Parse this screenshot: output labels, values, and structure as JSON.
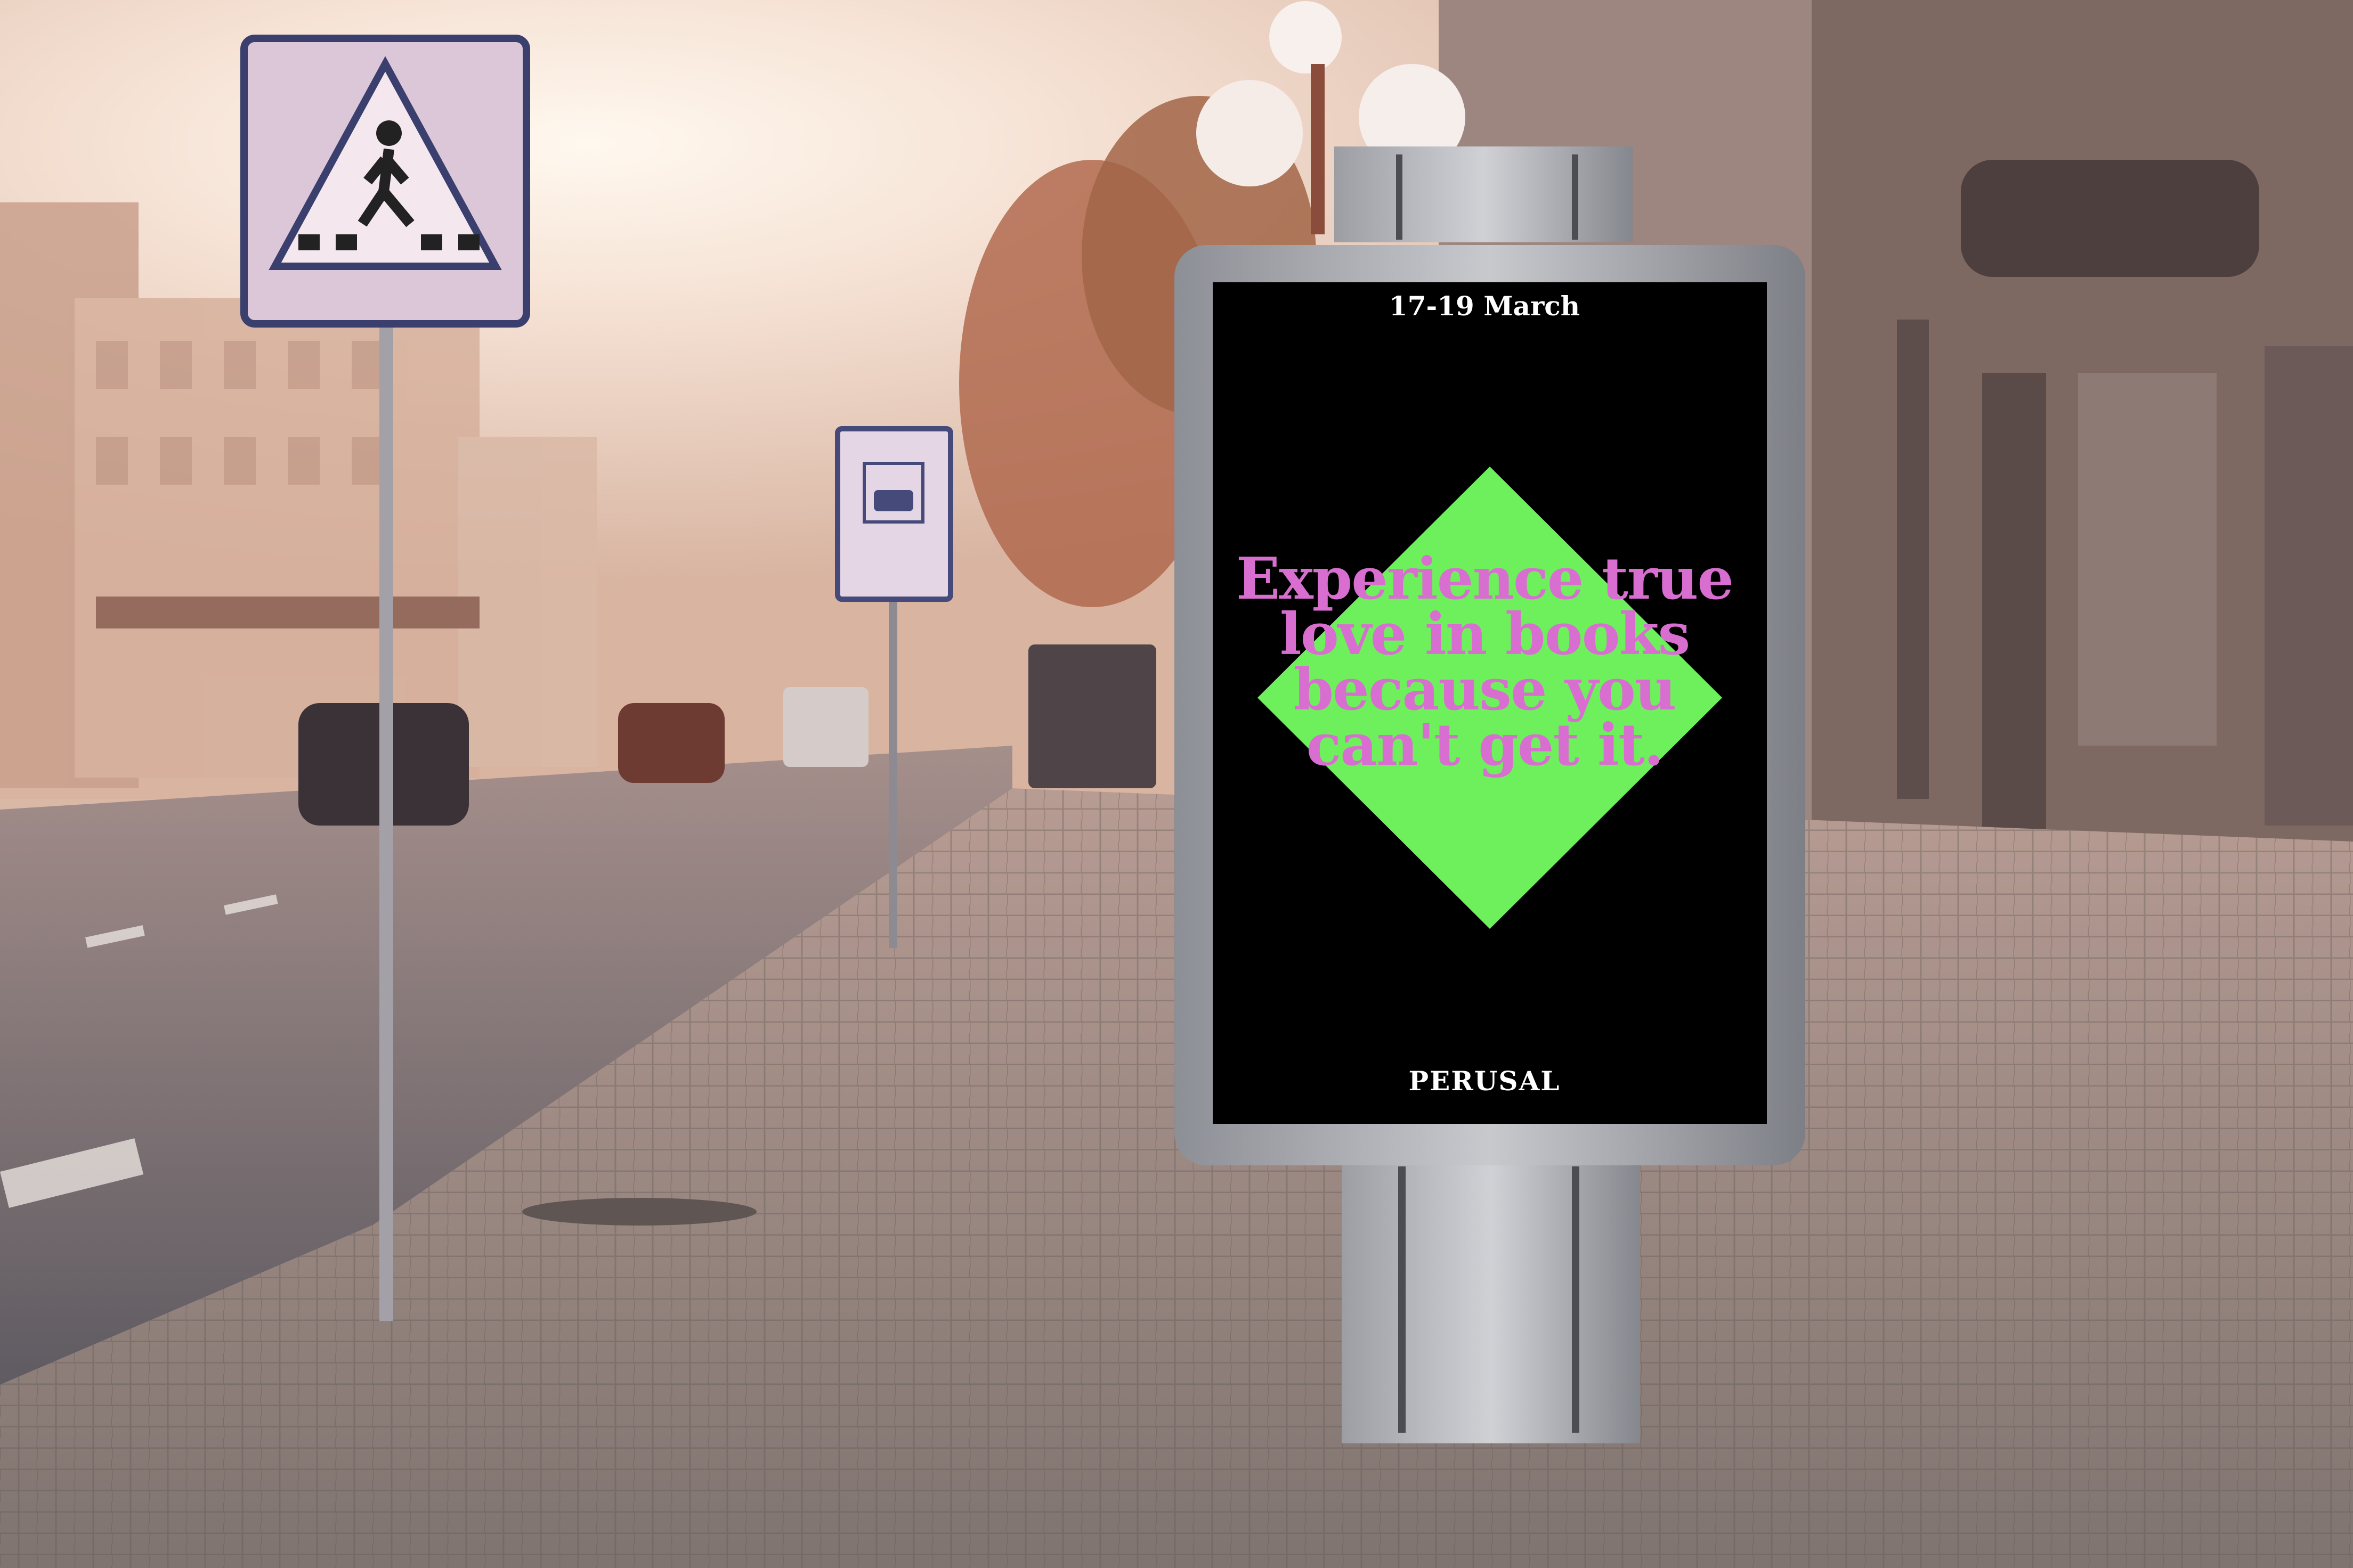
{
  "scene": {
    "description_free": true,
    "colors": {
      "sky": "#f3e6dd",
      "sun_glow": "#fff4e8",
      "building": "#c9a791",
      "pavement": "#8c7f7b",
      "road": "#6f6b70",
      "poster_background": "#000000",
      "poster_diamond": "#6df05c",
      "poster_headline": "#d86fd0",
      "poster_text": "#ffffff",
      "sign_frame": "#3a3f6e"
    }
  },
  "poster": {
    "date": "17-19 March",
    "headline_lines": [
      "Experience true",
      "love in books",
      "because you",
      "can't get it."
    ],
    "brand": "PERUSAL"
  }
}
